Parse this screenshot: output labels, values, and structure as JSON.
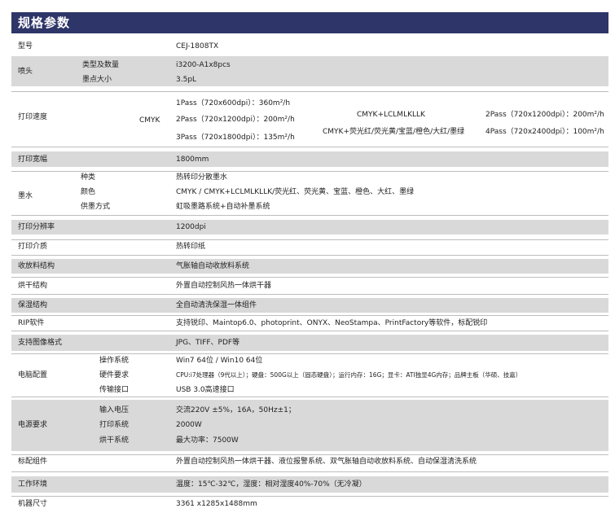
{
  "title": "规格参数",
  "rows": {
    "model": {
      "label": "型号",
      "value": "CEJ-1808TX"
    },
    "head": {
      "label": "喷头",
      "sub1": "类型及数量",
      "val1": "i3200-A1x8pcs",
      "sub2": "墨点大小",
      "val2": "3.5pL"
    },
    "speed": {
      "label": "打印速度",
      "mode_left": "CMYK",
      "left": [
        "1Pass（720x600dpi）：360m²/h",
        "2Pass（720x1200dpi）：200m²/h",
        "3Pass（720x1800dpi）：135m²/h"
      ],
      "mode_mid1": "CMYK+LCLMLKLLK",
      "mode_mid2": "CMYK+荧光红/荧光黄/宝蓝/橙色/大红/墨绿",
      "right": [
        "2Pass（720x1200dpi）：200m²/h",
        "4Pass（720x2400dpi）：100m²/h"
      ]
    },
    "width": {
      "label": "打印宽幅",
      "value": "1800mm"
    },
    "ink": {
      "label": "墨水",
      "sub1": "种类",
      "val1": "热转印分散墨水",
      "sub2": "颜色",
      "val2": "CMYK / CMYK+LCLMLKLLK/荧光红、荧光黄、宝蓝、橙色、大红、墨绿",
      "sub3": "供墨方式",
      "val3": "虹吸墨路系统+自动补墨系统"
    },
    "resolution": {
      "label": "打印分辨率",
      "value": "1200dpi"
    },
    "media": {
      "label": "打印介质",
      "value": "热转印纸"
    },
    "takeup": {
      "label": "收放料结构",
      "value": "气胀轴自动收放料系统"
    },
    "dryer": {
      "label": "烘干结构",
      "value": "外置自动控制风热一体烘干器"
    },
    "maintain": {
      "label": "保湿结构",
      "value": "全自动清洗保湿一体组件"
    },
    "rip": {
      "label": "RIP软件",
      "value": "支持锐印、Maintop6.0、photoprint、ONYX、NeoStampa、PrintFactory等软件，标配锐印"
    },
    "formats": {
      "label": "支持图像格式",
      "value": "JPG、TIFF、PDF等"
    },
    "pc": {
      "label": "电脑配置",
      "sub1": "操作系统",
      "val1": "Win7 64位 / Win10 64位",
      "sub2": "硬件要求",
      "val2": "CPU:i7处理器（9代以上）；硬盘：500G以上（固态硬盘）；运行内存：16G；显卡：ATI独显4G内存；品牌主板（华硕、技嘉）",
      "sub3": "传输接口",
      "val3": "USB 3.0高速接口"
    },
    "power": {
      "label": "电源要求",
      "sub1": "输入电压",
      "val1": "交流220V ±5%，16A，50Hz±1；",
      "sub2": "打印系统",
      "val2": "2000W",
      "sub3": "烘干系统",
      "val3": "最大功率：7500W"
    },
    "standard": {
      "label": "标配组件",
      "value": "外置自动控制风热一体烘干器、液位报警系统、双气胀轴自动收放料系统、自动保湿清洗系统"
    },
    "env": {
      "label": "工作环境",
      "value": "温度：15℃-32℃，湿度：相对湿度40%-70%（无冷凝）"
    },
    "size": {
      "label": "机器尺寸",
      "value": "3361 x1285x1488mm"
    }
  }
}
